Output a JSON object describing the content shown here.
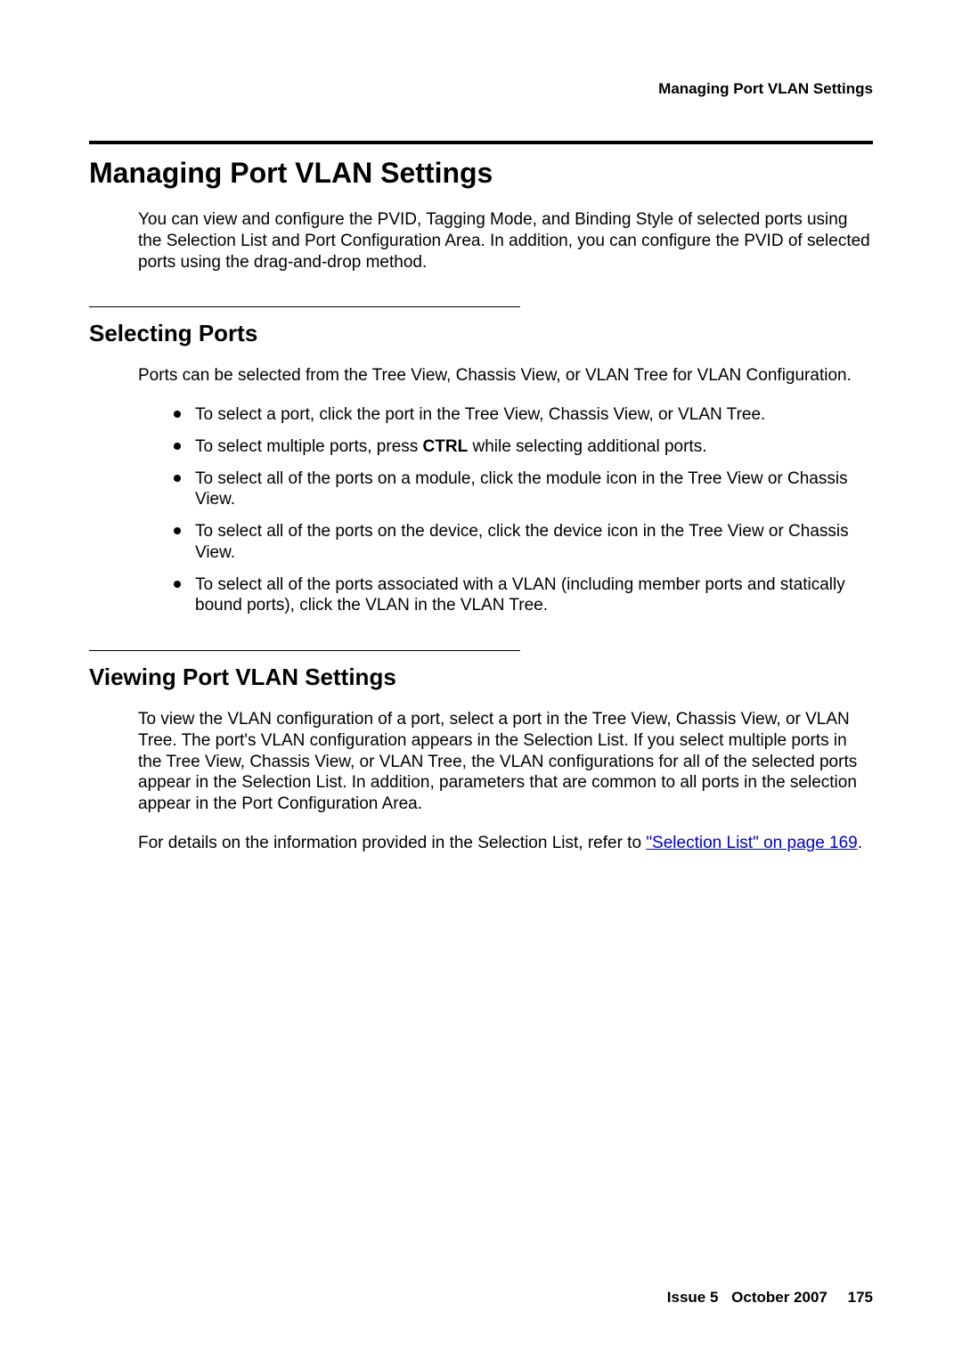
{
  "running_head": "Managing Port VLAN Settings",
  "title": "Managing Port VLAN Settings",
  "intro": "You can view and configure the PVID, Tagging Mode, and Binding Style of selected ports using the Selection List and Port Configuration Area. In addition, you can configure the PVID of selected ports using the drag-and-drop method.",
  "selecting": {
    "heading": "Selecting Ports",
    "lead": "Ports can be selected from the Tree View, Chassis View, or VLAN Tree for VLAN Configuration.",
    "bullets": {
      "b1": "To select a port, click the port in the Tree View, Chassis View, or VLAN Tree.",
      "b2_pre": "To select multiple ports, press ",
      "b2_bold": "CTRL",
      "b2_post": " while selecting additional ports.",
      "b3": "To select all of the ports on a module, click the module icon in the Tree View or Chassis View.",
      "b4": "To select all of the ports on the device, click the device icon in the Tree View or Chassis View.",
      "b5": "To select all of the ports associated with a VLAN (including member ports and statically bound ports), click the VLAN in the VLAN Tree."
    }
  },
  "viewing": {
    "heading": "Viewing Port VLAN Settings",
    "p1": "To view the VLAN configuration of a port, select a port in the Tree View, Chassis View, or VLAN Tree. The port's VLAN configuration appears in the Selection List. If you select multiple ports in the Tree View, Chassis View, or VLAN Tree, the VLAN configurations for all of the selected ports appear in the Selection List. In addition, parameters that are common to all ports in the selection appear in the Port Configuration Area.",
    "p2_pre": "For details on the information provided in the Selection List, refer to ",
    "p2_link": "\"Selection List\" on page 169",
    "p2_post": "."
  },
  "footer": {
    "issue": "Issue 5",
    "date": "October 2007",
    "page": "175"
  }
}
